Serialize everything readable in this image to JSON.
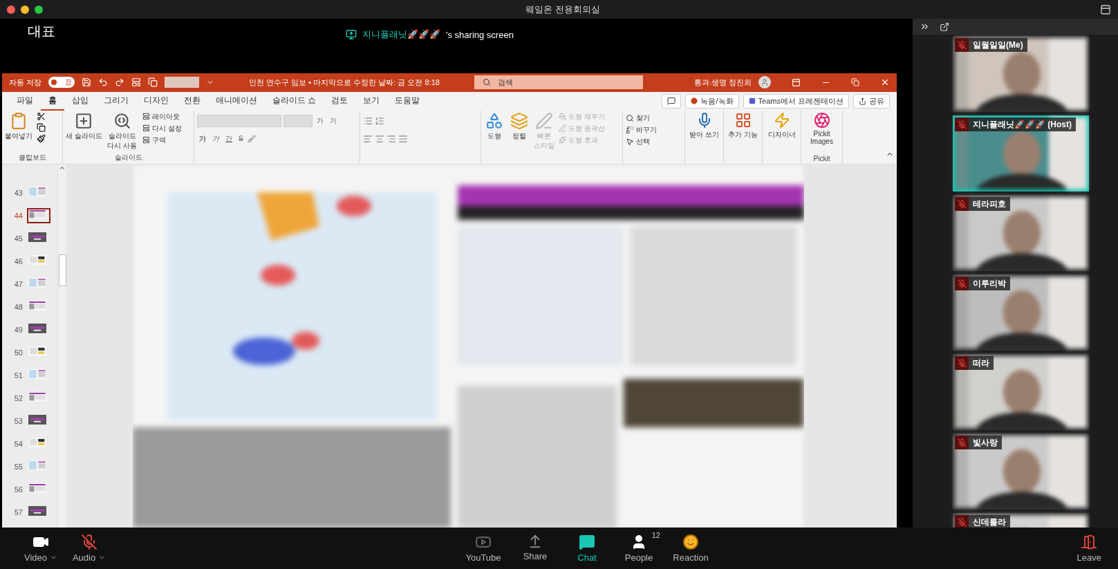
{
  "window": {
    "title": "웨일온 전용회의실"
  },
  "stage": {
    "label": "대표",
    "sharing": {
      "name": "지니플래닛🚀🚀🚀",
      "suffix": "'s sharing screen"
    }
  },
  "ppt": {
    "title_bar": {
      "autosave_label": "자동 저장",
      "autosave_on": false,
      "autosave_state": "끔",
      "document": "인천 연수구 임보 • 마지막으로 수정한 날짜: 금 오전 8:18",
      "search_placeholder": "검색",
      "user": "통과.생명 정진희"
    },
    "tabs": [
      {
        "label": "파일",
        "selected": false
      },
      {
        "label": "홈",
        "selected": true
      },
      {
        "label": "삽입",
        "selected": false
      },
      {
        "label": "그리기",
        "selected": false
      },
      {
        "label": "디자인",
        "selected": false
      },
      {
        "label": "전환",
        "selected": false
      },
      {
        "label": "애니메이션",
        "selected": false
      },
      {
        "label": "슬라이드 쇼",
        "selected": false
      },
      {
        "label": "검토",
        "selected": false
      },
      {
        "label": "보기",
        "selected": false
      },
      {
        "label": "도움말",
        "selected": false
      }
    ],
    "actions": [
      {
        "kind": "record",
        "label": "녹음/녹화"
      },
      {
        "kind": "teams",
        "label": "Teams에서 프레젠테이션"
      },
      {
        "kind": "share",
        "label": "공유"
      }
    ],
    "ribbon": {
      "clipboard": {
        "paste": "붙여넣기",
        "label": "클립보드"
      },
      "slides": {
        "new": "새 슬라이드",
        "reuse": "슬라이드 다시 사용",
        "small": [
          "레이아웃",
          "다시 설정",
          "구역"
        ],
        "label": "슬라이드"
      },
      "font": {
        "size_buttons": [
          "가",
          "가"
        ],
        "styles": [
          "가",
          "가",
          "간",
          "S"
        ]
      },
      "drawing": {
        "big": [
          {
            "label": "도형",
            "disabled": false
          },
          {
            "label": "정렬",
            "disabled": false
          },
          {
            "label": "빠른 스타일",
            "disabled": true
          }
        ],
        "small": [
          {
            "label": "도형 채우기",
            "disabled": true
          },
          {
            "label": "도형 윤곽선",
            "disabled": true
          },
          {
            "label": "도형 효과",
            "disabled": true
          }
        ]
      },
      "editing": [
        "찾기",
        "바꾸기",
        "선택"
      ],
      "addins": [
        {
          "kind": "mic",
          "label": "받아 쓰기"
        },
        {
          "kind": "grid",
          "label": "추가 기능"
        },
        {
          "kind": "designer",
          "label": "디자이너"
        },
        {
          "kind": "pickit",
          "label": "Pickit Images"
        }
      ],
      "pickit_label": "Pickit"
    },
    "slides": [
      {
        "number": "43",
        "selected": false
      },
      {
        "number": "44",
        "selected": true
      },
      {
        "number": "45",
        "selected": false
      },
      {
        "number": "46",
        "selected": false
      },
      {
        "number": "47",
        "selected": false
      },
      {
        "number": "48",
        "selected": false
      },
      {
        "number": "49",
        "selected": false
      },
      {
        "number": "50",
        "selected": false
      },
      {
        "number": "51",
        "selected": false
      },
      {
        "number": "52",
        "selected": false
      },
      {
        "number": "53",
        "selected": false
      },
      {
        "number": "54",
        "selected": false
      },
      {
        "number": "55",
        "selected": false
      },
      {
        "number": "56",
        "selected": false
      },
      {
        "number": "57",
        "selected": false
      }
    ]
  },
  "participants": [
    {
      "name": "일월일일(Me)",
      "muted": true,
      "speaking": false
    },
    {
      "name": "지니플래닛🚀🚀🚀 (Host)",
      "muted": true,
      "speaking": true
    },
    {
      "name": "테라피호",
      "muted": true,
      "speaking": false
    },
    {
      "name": "이루리박",
      "muted": true,
      "speaking": false
    },
    {
      "name": "떠라",
      "muted": true,
      "speaking": false
    },
    {
      "name": "빛사랑",
      "muted": true,
      "speaking": false
    },
    {
      "name": "신데룰라",
      "muted": true,
      "speaking": false
    }
  ],
  "controls_left": [
    {
      "kind": "video",
      "label": "Video",
      "muted": false
    },
    {
      "kind": "audio",
      "label": "Audio",
      "muted": true
    }
  ],
  "controls_center": [
    {
      "kind": "youtube",
      "label": "YouTube",
      "selected": false
    },
    {
      "kind": "share",
      "label": "Share",
      "selected": false
    },
    {
      "kind": "chat",
      "label": "Chat",
      "selected": true
    },
    {
      "kind": "people",
      "label": "People",
      "count": "12",
      "selected": false
    },
    {
      "kind": "reaction",
      "label": "Reaction",
      "selected": false
    }
  ],
  "leave": "Leave"
}
